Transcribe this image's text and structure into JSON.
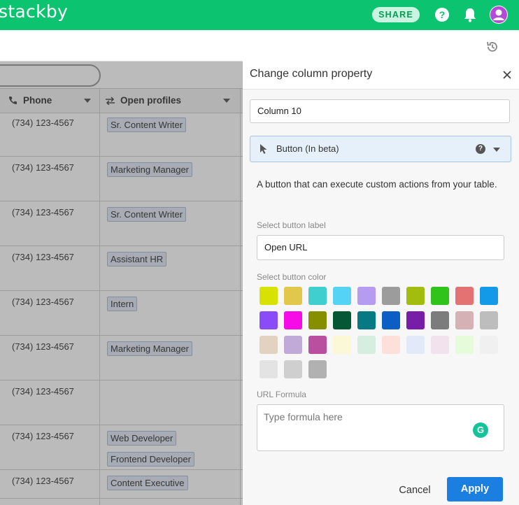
{
  "topbar": {
    "logo": "stackby",
    "share_label": "SHARE",
    "help_icon": "?",
    "bell_icon": "bell-icon",
    "avatar_icon": "user-avatar-icon",
    "color": "#0cc46f"
  },
  "subbar": {
    "history_icon": "history-icon"
  },
  "grid": {
    "columns": [
      {
        "label": "Phone",
        "icon": "phone-icon"
      },
      {
        "label": "Open profiles",
        "icon": "link-arrows-icon"
      }
    ],
    "rows": [
      {
        "phone": "(734) 123-4567",
        "profiles": [
          "Sr. Content Writer"
        ]
      },
      {
        "phone": "(734) 123-4567",
        "profiles": [
          "Marketing Manager"
        ]
      },
      {
        "phone": "(734) 123-4567",
        "profiles": [
          "Sr. Content Writer"
        ]
      },
      {
        "phone": "(734) 123-4567",
        "profiles": [
          "Assistant HR"
        ]
      },
      {
        "phone": "(734) 123-4567",
        "profiles": [
          "Intern"
        ]
      },
      {
        "phone": "(734) 123-4567",
        "profiles": [
          "Marketing Manager"
        ]
      },
      {
        "phone": "(734) 123-4567",
        "profiles": []
      },
      {
        "phone": "(734) 123-4567",
        "profiles": [
          "Web Developer",
          "Frontend Developer"
        ]
      },
      {
        "phone": "(734) 123-4567",
        "profiles": [
          "Content Executive"
        ]
      }
    ]
  },
  "panel": {
    "title": "Change column property",
    "close_icon": "close-icon",
    "column_name": "Column 10",
    "column_type": "Button (In beta)",
    "type_help": "?",
    "description": "A button that can execute custom actions from your table.",
    "button_label_heading": "Select button label",
    "button_label_value": "Open URL",
    "button_color_heading": "Select button color",
    "colors": [
      "#d7e200",
      "#e1c74a",
      "#3fcfcf",
      "#54d3f5",
      "#b59cf0",
      "#9c9c9c",
      "#a3bd0f",
      "#2fc31c",
      "#e57272",
      "#129ae8",
      "#8a4cf6",
      "#f60be6",
      "#858f00",
      "#045833",
      "#057a82",
      "#0b5fc4",
      "#781da7",
      "#7c7c7c",
      "#d5b0b5",
      "#bdbdbd",
      "#e2d3c1",
      "#c2aad8",
      "#bb4f9f",
      "#fbf8d6",
      "#d6eee0",
      "#fde0da",
      "#e2e9f8",
      "#f1e2ee",
      "#e5fbd9",
      "#f0f0f0",
      "#e3e3e3",
      "#cfcfcf",
      "#b1b1b1"
    ],
    "formula_heading": "URL Formula",
    "formula_placeholder": "Type formula here",
    "grammarly_glyph": "G",
    "cancel_label": "Cancel",
    "apply_label": "Apply"
  }
}
